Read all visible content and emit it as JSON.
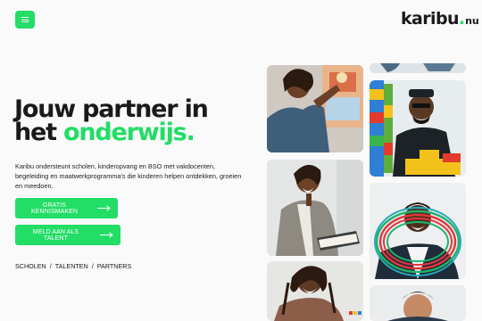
{
  "header": {
    "menu_icon": "hamburger-icon",
    "logo": {
      "main": "karibu",
      "dot": ".",
      "tld": "nu"
    },
    "accent_color": "#22dd66"
  },
  "hero": {
    "headline_line1": "Jouw partner in",
    "headline_line2_plain": "het ",
    "headline_line2_accent": "onderwijs.",
    "intro": "Karibu ondersteunt scholen, kinderopvang en BSO met vakdocenten, begeleiding en maatwerkprogramma's die kinderen helpen ontdekken, groeien en meedoen.",
    "cta_primary": "GRATIS KENNISMAKEN",
    "cta_secondary": "MELD AAN ALS TALENT",
    "cta_icon": "arrow-right-icon"
  },
  "audiences": [
    "SCHOLEN",
    "TALENTEN",
    "PARTNERS"
  ],
  "audience_separator": "/",
  "gallery": [
    "woman-painting-photo",
    "man-lego-wall-photo",
    "woman-laughing-photo",
    "man-hula-hoops-photo",
    "woman-braids-photo",
    "man-smiling-photo",
    "top-cropped-photo"
  ]
}
